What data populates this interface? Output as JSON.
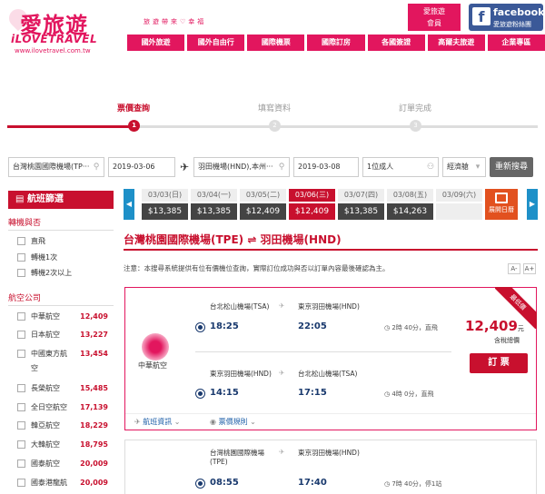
{
  "header": {
    "logo_main": "愛旅遊",
    "logo_sub": "iLOVETRAVEL",
    "logo_url": "www.ilovetravel.com.tw",
    "slogan": "旅遊帶來♡幸福",
    "member_line1": "愛旅遊",
    "member_line2": "會員",
    "fb_label": "facebook",
    "fb_sub": "愛旅遊粉絲團"
  },
  "nav": [
    "國外旅遊",
    "國外自由行",
    "國際機票",
    "國際訂房",
    "各國簽證",
    "高爾夫旅遊",
    "企業專區"
  ],
  "steps": [
    {
      "label": "票價查詢",
      "num": "1",
      "active": true
    },
    {
      "label": "填寫資料",
      "num": "2",
      "active": false
    },
    {
      "label": "訂單完成",
      "num": "3",
      "active": false
    }
  ],
  "search": {
    "from": "台灣桃園國際機場(TP‧‧‧",
    "depart_date": "2019-03-06",
    "to": "羽田機場(HND),本州‧‧‧",
    "return_date": "2019-03-08",
    "pax": "1位成人",
    "cabin": "經濟艙",
    "button": "重新搜尋"
  },
  "filter": {
    "title": "航班篩選",
    "transfer_title": "轉機與否",
    "transfer": [
      "直飛",
      "轉機1次",
      "轉機2次以上"
    ],
    "airline_title": "航空公司",
    "airlines": [
      {
        "name": "中華航空",
        "price": "12,409"
      },
      {
        "name": "日本航空",
        "price": "13,227"
      },
      {
        "name": "中國東方航",
        "price": "13,454"
      },
      {
        "name": "空",
        "price": ""
      },
      {
        "name": "長榮航空",
        "price": "15,485"
      },
      {
        "name": "全日空航空",
        "price": "17,139"
      },
      {
        "name": "韓亞航空",
        "price": "18,229"
      },
      {
        "name": "大韓航空",
        "price": "18,795"
      },
      {
        "name": "國泰航空",
        "price": "20,009"
      },
      {
        "name": "國泰港龍航",
        "price": "20,009"
      }
    ]
  },
  "dates": [
    {
      "d": "03/03(日)",
      "p": "$13,385",
      "state": "normal"
    },
    {
      "d": "03/04(一)",
      "p": "$13,385",
      "state": "normal"
    },
    {
      "d": "03/05(二)",
      "p": "$12,409",
      "state": "normal"
    },
    {
      "d": "03/06(三)",
      "p": "$12,409",
      "state": "sel"
    },
    {
      "d": "03/07(四)",
      "p": "$13,385",
      "state": "normal"
    },
    {
      "d": "03/08(五)",
      "p": "$14,263",
      "state": "normal"
    },
    {
      "d": "03/09(六)",
      "p": "",
      "state": "na"
    }
  ],
  "dates_cal": "展開日曆",
  "route": "台灣桃園國際機場(TPE) ⇌ 羽田機場(HND)",
  "notice": "注意：本搜尋系統提供有位有價機位查詢，實際訂位成功與否以訂單內容最後確認為主。",
  "font_small": "A-",
  "font_big": "A+",
  "card1": {
    "ribbon": "最低價",
    "airline": "中華航空",
    "out_from": "台北松山機場(TSA)",
    "out_to": "東京羽田機場(HND)",
    "out_dep": "18:25",
    "out_arr": "22:05",
    "out_dur": "2時 40分，直飛",
    "ret_from": "東京羽田機場(HND)",
    "ret_to": "台北松山機場(TSA)",
    "ret_dep": "14:15",
    "ret_arr": "17:15",
    "ret_dur": "4時 0分，直飛",
    "price": "12,409",
    "price_unit": "元",
    "price_note": "含稅總價",
    "buy": "訂 票",
    "info": "航班資訊",
    "rules": "票價規則"
  },
  "card2": {
    "out_from": "台灣桃園國際機場",
    "out_from2": "(TPE)",
    "out_to": "東京羽田機場(HND)",
    "out_dep": "08:55",
    "out_arr": "17:40",
    "out_dur": "7時 40分，停1站"
  },
  "colors": {
    "brand": "#e2165e",
    "accent": "#c8102e",
    "link": "#1e5fa8"
  }
}
